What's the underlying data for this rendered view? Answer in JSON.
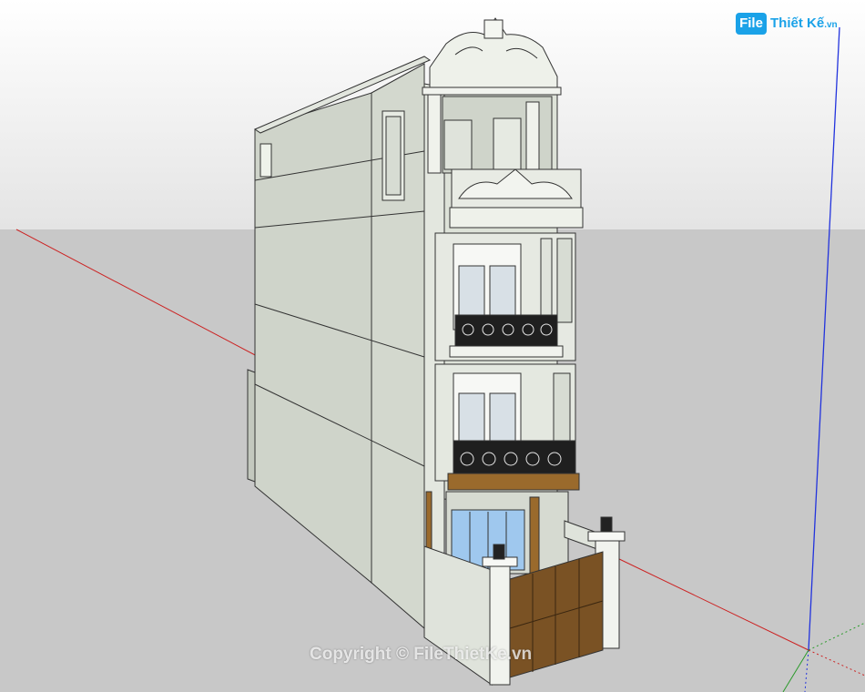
{
  "app": {
    "kind": "3D modeling viewport",
    "colors": {
      "sky_top": "#ffffff",
      "sky_bottom": "#e4e4e4",
      "ground": "#c8c8c8",
      "wall": "#d7dcd3",
      "wall_side": "#c9cec4",
      "trim": "#ecefe8",
      "glass": "#9fc8ee",
      "wood": "#9a6a2c",
      "iron": "#222222",
      "axis_red": "#cc2222",
      "axis_green": "#2a9a2a",
      "axis_blue": "#2233dd"
    }
  },
  "logo": {
    "icon_text": "File",
    "brand_text": "Thiết Kế",
    "tld": ".vn"
  },
  "watermark": {
    "text": "Copyright © FileThietKe.vn"
  },
  "model": {
    "name_icon": "townhouse-model",
    "axes": [
      "red-axis",
      "green-axis",
      "blue-axis"
    ]
  }
}
